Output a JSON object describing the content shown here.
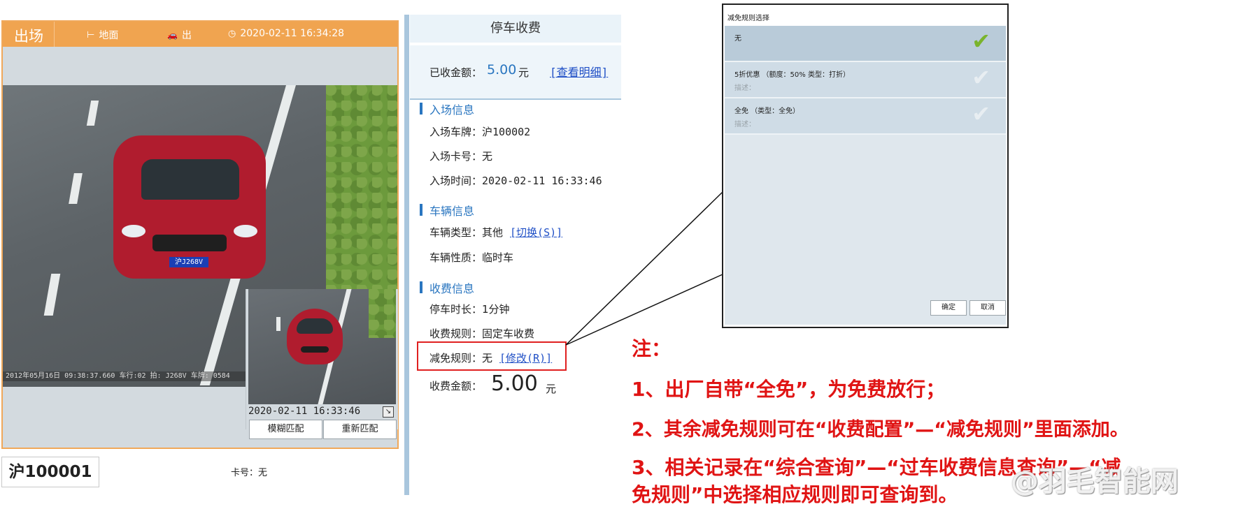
{
  "camera": {
    "mode": "出场",
    "location": "地面",
    "direction": "出",
    "datetime": "2020-02-11 16:34:28",
    "overlay_text": "2012年05月16日 09:38:37.660 车行:02 拍: J268V   车牌: 0584",
    "car_plate": "沪J268V",
    "inset_time": "2020-02-11 16:33:46",
    "buttons": {
      "fuzzy_match": "模糊匹配",
      "rematch": "重新匹配"
    },
    "plate_number": "沪100001",
    "card": "卡号：无"
  },
  "fee": {
    "title": "停车收费",
    "collected_label": "已收金额：",
    "collected_amount": "5.00",
    "collected_unit": "元",
    "view_detail": "[查看明细]",
    "entry_section": "入场信息",
    "entry_plate_label": "入场车牌：",
    "entry_plate": "沪100002",
    "entry_card_label": "入场卡号：",
    "entry_card": "无",
    "entry_time_label": "入场时间：",
    "entry_time": "2020-02-11 16:33:46",
    "vehicle_section": "车辆信息",
    "vehicle_type_label": "车辆类型：",
    "vehicle_type": "其他",
    "switch_link": "[切换(S)]",
    "vehicle_nature_label": "车辆性质：",
    "vehicle_nature": "临时车",
    "charge_section": "收费信息",
    "duration_label": "停车时长：",
    "duration": "1分钟",
    "rule_label": "收费规则：",
    "rule": "固定车收费",
    "discount_label": "减免规则：",
    "discount": "无",
    "modify_link": "[修改(R)]",
    "amount_label": "收费金额：",
    "amount": "5.00",
    "amount_unit": "元"
  },
  "dialog": {
    "title": "减免规则选择",
    "items": [
      {
        "name": "无",
        "desc": ""
      },
      {
        "name": "5折优惠  （额度：50%   类型：打折）",
        "desc": "描述："
      },
      {
        "name": "全免  （类型：全免）",
        "desc": "描述："
      }
    ],
    "ok": "确定",
    "cancel": "取消"
  },
  "notes": {
    "heading": "注：",
    "line1": "1、出厂自带“全免”，为免费放行；",
    "line2": "2、其余减免规则可在“收费配置”—“减免规则”里面添加。",
    "line3a": "3、相关记录在“综合查询”—“过车收费信息查询”—“减",
    "line3b": "免规则”中选择相应规则即可查询到。"
  },
  "watermark": "@羽毛智能网",
  "colors": {
    "header_orange": "#f0a450",
    "accent_blue": "#2a76c0",
    "note_red": "#e01414",
    "check_green": "#7ab42c"
  }
}
